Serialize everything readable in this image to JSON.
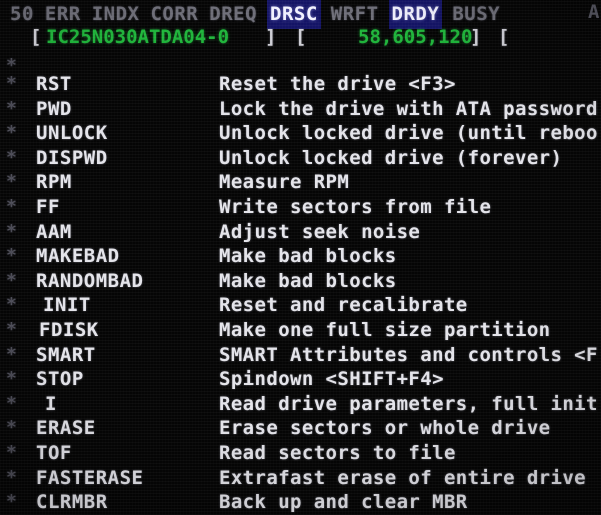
{
  "status_bar": {
    "leading_number": "50",
    "flags": [
      {
        "label": "ERR",
        "state": "normal"
      },
      {
        "label": "INDX",
        "state": "normal"
      },
      {
        "label": "CORR",
        "state": "normal"
      },
      {
        "label": "DREQ",
        "state": "normal"
      },
      {
        "label": "DRSC",
        "state": "active"
      },
      {
        "label": "WRFT",
        "state": "normal"
      },
      {
        "label": "DRDY",
        "state": "active"
      },
      {
        "label": "BUSY",
        "state": "normal"
      }
    ],
    "right_glyph": "A",
    "active_color": "#141466",
    "normal_color": "#6e6e78",
    "active_text_color": "#f2f2ff"
  },
  "info_bar": {
    "bracket_open": "[",
    "model": "IC25N030ATDA04-0",
    "bracket_close": "]",
    "bracket_open2": "[",
    "lba_count": "58,605,120",
    "bracket_close2": "]",
    "bracket_open3": "[",
    "green_color": "#1eb43a",
    "bracket_color": "#cfcfd6"
  },
  "commands": {
    "bullet_glyph": "*",
    "items": [
      {
        "name": "RST",
        "desc": "Reset the drive <F3>"
      },
      {
        "name": "PWD",
        "desc": "Lock the drive with ATA password"
      },
      {
        "name": "UNLOCK",
        "desc": "Unlock locked drive (until reboo"
      },
      {
        "name": "DISPWD",
        "desc": "Unlock locked drive (forever)"
      },
      {
        "name": "RPM",
        "desc": "Measure RPM"
      },
      {
        "name": "FF",
        "desc": "Write sectors from file"
      },
      {
        "name": "AAM",
        "desc": "Adjust seek noise"
      },
      {
        "name": "MAKEBAD",
        "desc": "Make bad blocks"
      },
      {
        "name": "RANDOMBAD",
        "desc": "Make bad blocks"
      },
      {
        "name": "INIT",
        "desc": "Reset and recalibrate"
      },
      {
        "name": "FDISK",
        "desc": "Make one full size partition"
      },
      {
        "name": "SMART",
        "desc": "SMART Attributes and controls <F"
      },
      {
        "name": "STOP",
        "desc": "Spindown <SHIFT+F4>"
      },
      {
        "name": "I",
        "desc": "Read drive parameters, full init"
      },
      {
        "name": "ERASE",
        "desc": "Erase sectors or whole drive"
      },
      {
        "name": "TOF",
        "desc": "Read sectors to file"
      },
      {
        "name": "FASTERASE",
        "desc": "Extrafast erase of entire drive"
      },
      {
        "name": "CLRMBR",
        "desc": "Back up and clear MBR"
      }
    ]
  }
}
